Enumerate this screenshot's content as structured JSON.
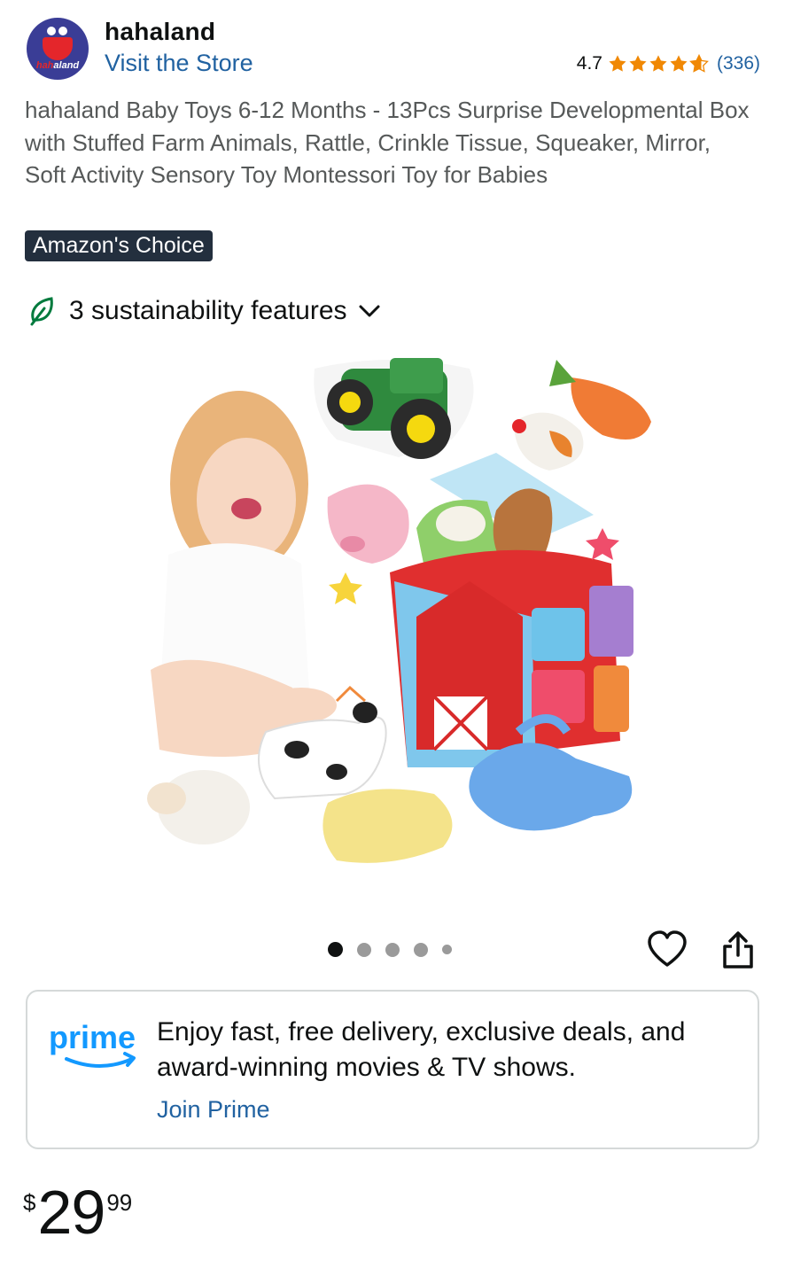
{
  "store": {
    "logo_text_red": "hah",
    "logo_text_white": "aland",
    "name": "hahaland",
    "visit_label": "Visit the Store",
    "rating_value": "4.7",
    "rating_count": "(336)",
    "stars": 4.7
  },
  "product": {
    "title": "hahaland Baby Toys 6-12 Months - 13Pcs Surprise Developmental Box with Stuffed Farm Animals, Rattle, Crinkle Tissue, Squeaker, Mirror, Soft Activity Sensory Toy Montessori Toy for Babies",
    "badge": "Amazon's Choice",
    "image_icon": "product-photo-baby-with-farm-toy-box"
  },
  "sustainability": {
    "label": "3 sustainability features",
    "icon": "leaf-icon"
  },
  "carousel": {
    "total": 5,
    "active_index": 0
  },
  "actions": {
    "wishlist_icon": "heart-icon",
    "share_icon": "share-icon"
  },
  "prime": {
    "logo_word": "prime",
    "message": "Enjoy fast, free delivery, exclusive deals, and award-winning movies & TV shows.",
    "cta": "Join Prime"
  },
  "price": {
    "symbol": "$",
    "whole": "29",
    "fraction": "99"
  },
  "colors": {
    "link": "#2162a1",
    "star": "#f08804",
    "badge_bg": "#232f3e",
    "prime_blue": "#1399ff",
    "sustain_green": "#007a3d"
  }
}
